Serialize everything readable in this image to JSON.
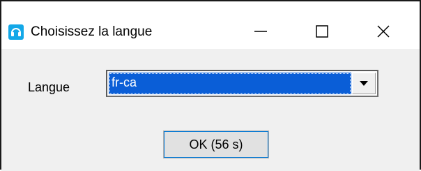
{
  "window": {
    "title": "Choisissez la langue",
    "icon": "headset-icon"
  },
  "title_buttons": {
    "minimize": "minimize-icon",
    "maximize": "maximize-icon",
    "close": "close-icon"
  },
  "form": {
    "language_label": "Langue",
    "language_value": "fr-ca",
    "ok_label": "OK (56 s)"
  },
  "colors": {
    "app_icon": "#13a8e8",
    "selection": "#0a5ed7"
  }
}
